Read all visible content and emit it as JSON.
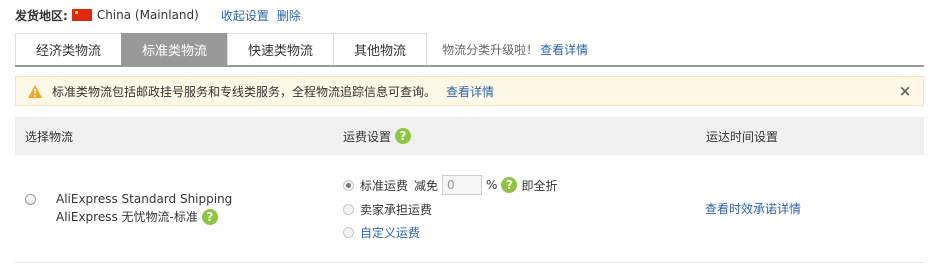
{
  "origin": {
    "label": "发货地区:",
    "value": "China (Mainland)",
    "collapse_link": "收起设置",
    "delete_link": "删除"
  },
  "tabs": [
    {
      "label": "经济类物流"
    },
    {
      "label": "标准类物流"
    },
    {
      "label": "快速类物流"
    },
    {
      "label": "其他物流"
    }
  ],
  "tabs_note": {
    "text": "物流分类升级啦！",
    "link": "查看详情"
  },
  "notice": {
    "text": "标准类物流包括邮政挂号服务和专线类服务，全程物流追踪信息可查询。",
    "link": "查看详情",
    "close": "×"
  },
  "table": {
    "headers": {
      "select": "选择物流",
      "fee": "运费设置",
      "time": "运达时间设置"
    },
    "row": {
      "name_line1": "AliExpress Standard Shipping",
      "name_line2": "AliExpress 无忧物流-标准",
      "fee_options": {
        "standard": "标准运费",
        "reduce": "减免",
        "discount_value": "0",
        "percent": "%",
        "full_discount": "即全折",
        "seller": "卖家承担运费",
        "custom": "自定义运费"
      },
      "time_link": "查看时效承诺详情"
    }
  },
  "colors": {
    "link": "#2d64b3",
    "active_tab": "#999999",
    "help_icon": "#8cc63f",
    "notice_bg": "#fff8e6",
    "warning": "#f5a623"
  }
}
